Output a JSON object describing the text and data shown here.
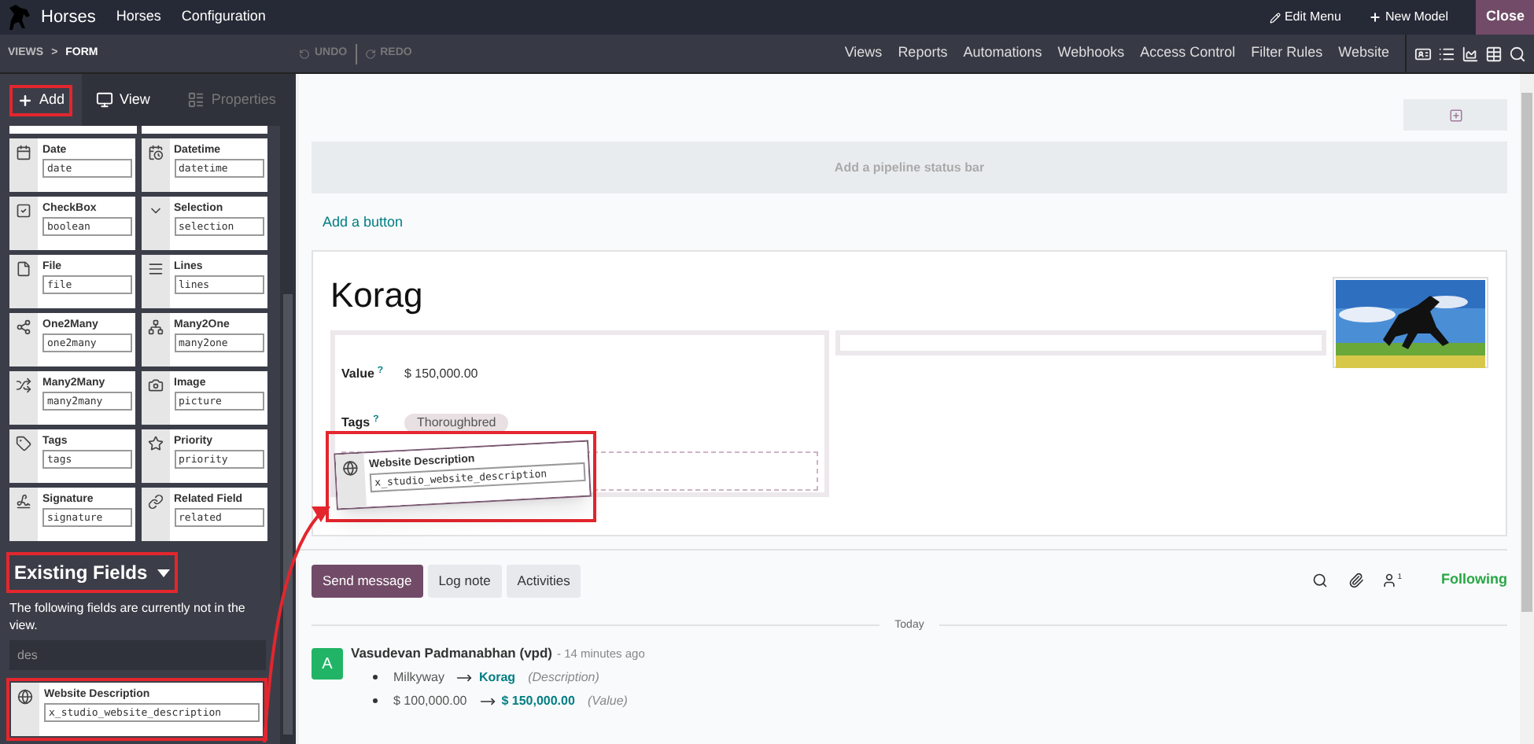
{
  "app": {
    "title": "Horses",
    "menu": [
      "Horses",
      "Configuration"
    ],
    "actions": [
      {
        "label": "Edit Menu",
        "kind": "edit"
      },
      {
        "label": "New Model",
        "kind": "add"
      }
    ],
    "close": "Close"
  },
  "breadcrumb": {
    "items": [
      "VIEWS",
      "FORM"
    ],
    "separator": ">"
  },
  "history": [
    {
      "label": "UNDO",
      "kind": "undo",
      "disabled": true
    },
    {
      "label": "REDO",
      "kind": "redo",
      "disabled": true
    }
  ],
  "studio_menu": [
    "Views",
    "Reports",
    "Automations",
    "Webhooks",
    "Access Control",
    "Filter Rules",
    "Website"
  ],
  "sidebar": {
    "tabs": [
      {
        "label": "Add",
        "kind": "add",
        "selected": true,
        "disabled": false,
        "highlighted": true
      },
      {
        "label": "View",
        "kind": "view",
        "selected": false,
        "disabled": false,
        "highlighted": false
      },
      {
        "label": "Properties",
        "kind": "properties",
        "selected": false,
        "disabled": true,
        "highlighted": false
      }
    ],
    "field_types": [
      {
        "label": "Date",
        "tech": "date",
        "kind": "date"
      },
      {
        "label": "Datetime",
        "tech": "datetime",
        "kind": "datetime"
      },
      {
        "label": "CheckBox",
        "tech": "boolean",
        "kind": "checkbox"
      },
      {
        "label": "Selection",
        "tech": "selection",
        "kind": "selection"
      },
      {
        "label": "File",
        "tech": "file",
        "kind": "file"
      },
      {
        "label": "Lines",
        "tech": "lines",
        "kind": "lines"
      },
      {
        "label": "One2Many",
        "tech": "one2many",
        "kind": "one2many"
      },
      {
        "label": "Many2One",
        "tech": "many2one",
        "kind": "many2one"
      },
      {
        "label": "Many2Many",
        "tech": "many2many",
        "kind": "many2many"
      },
      {
        "label": "Image",
        "tech": "picture"
      },
      {
        "label": "Tags",
        "tech": "tags",
        "kind": "tags"
      },
      {
        "label": "Priority",
        "tech": "priority",
        "kind": "priority"
      },
      {
        "label": "Signature",
        "tech": "signature",
        "kind": "signature"
      },
      {
        "label": "Related Field",
        "tech": "related",
        "kind": "related"
      }
    ],
    "existing_fields": {
      "title": "Existing Fields",
      "highlighted": true,
      "description": "The following fields are currently not in the view.",
      "search": {
        "value": "des"
      },
      "fields": [
        {
          "label": "Website Description",
          "tech": "x_studio_website_description",
          "highlighted": true
        }
      ]
    }
  },
  "form": {
    "status_bar_hint": "Add a pipeline status bar",
    "add_button": "Add a button",
    "title": "Korag",
    "fields": [
      {
        "label": "Value",
        "help": "?",
        "kind": "text",
        "value": "$ 150,000.00"
      },
      {
        "label": "Tags",
        "help": "?",
        "kind": "tags",
        "tags": [
          "Thoroughbred"
        ]
      }
    ],
    "dragged_field": {
      "label": "Website Description",
      "tech": "x_studio_website_description",
      "highlighted": true
    }
  },
  "chatter": {
    "buttons": [
      {
        "label": "Send message",
        "selected": true
      },
      {
        "label": "Log note",
        "selected": false
      },
      {
        "label": "Activities",
        "selected": false
      }
    ],
    "followers_count": "1",
    "follow_status": "Following",
    "divider": "Today",
    "messages": [
      {
        "avatar": "A",
        "author": "Vasudevan Padmanabhan (vpd)",
        "time": "- 14 minutes ago",
        "changes": [
          {
            "old": "Milkyway",
            "new": "Korag",
            "field": "(Description)"
          },
          {
            "old": "$ 100,000.00",
            "new": "$ 150,000.00",
            "field": "(Value)"
          }
        ]
      }
    ]
  }
}
